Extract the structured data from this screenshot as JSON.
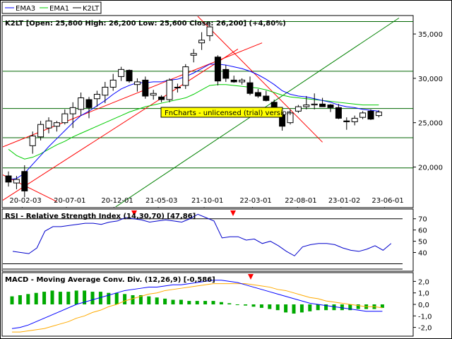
{
  "legend": {
    "ema3": "EMA3",
    "ema1": "EMA1",
    "k2lt": "K2LT"
  },
  "main_panel": {
    "header": "K2LT [Open: 25,800  High: 26,200  Low: 25,600  Close: 26,200] (+4,80%)",
    "watermark": "FnCharts - unlicensed (trial) version"
  },
  "rsi_panel": {
    "header": "RSI - Relative Strength Index (14,30,70) [47,86]"
  },
  "macd_panel": {
    "header": "MACD - Moving Average Conv. Div. (12,26,9) [-0,586]"
  },
  "colors": {
    "ema3": "#0000ff",
    "ema1": "#00cc00",
    "channel": "#ff0000",
    "trendline": "#008000",
    "hline": "#006600",
    "rsi": "#0000cc",
    "macd": "#0000ff",
    "macd_signal": "#ffaa00",
    "hist_pos": "#00aa00",
    "hist_neg": "#00aa00",
    "marker": "#ff0000",
    "watermark_bg": "#ffff00"
  },
  "chart_data": [
    {
      "type": "candlestick",
      "title": "K2LT",
      "x_labels": [
        "20-02-03",
        "20-07-01",
        "20-12-01",
        "21-05-03",
        "21-10-01",
        "22-03-01",
        "22-08-01",
        "23-01-02",
        "23-06-01"
      ],
      "ylim": [
        15500,
        37000
      ],
      "y_ticks": [
        20000,
        25000,
        30000,
        35000
      ],
      "y_tick_labels": [
        "20,000",
        "25,000",
        "30,000",
        "35,000"
      ],
      "candles": [
        {
          "o": 19000,
          "h": 19500,
          "l": 17800,
          "c": 18300
        },
        {
          "o": 18200,
          "h": 19000,
          "l": 17500,
          "c": 18600
        },
        {
          "o": 19500,
          "h": 20200,
          "l": 16600,
          "c": 17300
        },
        {
          "o": 22400,
          "h": 24000,
          "l": 21500,
          "c": 23500
        },
        {
          "o": 23400,
          "h": 25200,
          "l": 23000,
          "c": 24800
        },
        {
          "o": 24400,
          "h": 25600,
          "l": 23800,
          "c": 25200
        },
        {
          "o": 24600,
          "h": 25200,
          "l": 24000,
          "c": 25000
        },
        {
          "o": 25000,
          "h": 26500,
          "l": 24800,
          "c": 26000
        },
        {
          "o": 26000,
          "h": 27300,
          "l": 24400,
          "c": 26700
        },
        {
          "o": 26500,
          "h": 28400,
          "l": 25800,
          "c": 27800
        },
        {
          "o": 27600,
          "h": 27900,
          "l": 25500,
          "c": 26700
        },
        {
          "o": 27700,
          "h": 28600,
          "l": 26800,
          "c": 28200
        },
        {
          "o": 28100,
          "h": 29600,
          "l": 27200,
          "c": 29000
        },
        {
          "o": 29000,
          "h": 30500,
          "l": 28600,
          "c": 29800
        },
        {
          "o": 30200,
          "h": 31300,
          "l": 29700,
          "c": 31000
        },
        {
          "o": 30900,
          "h": 31000,
          "l": 29500,
          "c": 29700
        },
        {
          "o": 29300,
          "h": 30000,
          "l": 28500,
          "c": 29600
        },
        {
          "o": 29800,
          "h": 30200,
          "l": 27700,
          "c": 28000
        },
        {
          "o": 28100,
          "h": 28700,
          "l": 27600,
          "c": 28300
        },
        {
          "o": 27900,
          "h": 28100,
          "l": 27300,
          "c": 27600
        },
        {
          "o": 27600,
          "h": 30000,
          "l": 27300,
          "c": 29800
        },
        {
          "o": 29000,
          "h": 29400,
          "l": 28400,
          "c": 29000
        },
        {
          "o": 29200,
          "h": 31600,
          "l": 28800,
          "c": 31300
        },
        {
          "o": 32600,
          "h": 33300,
          "l": 31800,
          "c": 32800
        },
        {
          "o": 34000,
          "h": 35200,
          "l": 33200,
          "c": 34300
        },
        {
          "o": 34800,
          "h": 36200,
          "l": 34200,
          "c": 35800
        },
        {
          "o": 32400,
          "h": 32600,
          "l": 29200,
          "c": 29700
        },
        {
          "o": 31000,
          "h": 31500,
          "l": 29600,
          "c": 30000
        },
        {
          "o": 29800,
          "h": 30300,
          "l": 29500,
          "c": 29600
        },
        {
          "o": 29600,
          "h": 30000,
          "l": 29300,
          "c": 29800
        },
        {
          "o": 29500,
          "h": 30200,
          "l": 28100,
          "c": 28300
        },
        {
          "o": 28400,
          "h": 28800,
          "l": 27800,
          "c": 28000
        },
        {
          "o": 28000,
          "h": 28600,
          "l": 27400,
          "c": 27500
        },
        {
          "o": 27300,
          "h": 27600,
          "l": 26100,
          "c": 26400
        },
        {
          "o": 25900,
          "h": 26400,
          "l": 24100,
          "c": 24600
        },
        {
          "o": 25000,
          "h": 26500,
          "l": 24800,
          "c": 26100
        },
        {
          "o": 26300,
          "h": 27000,
          "l": 26100,
          "c": 26800
        },
        {
          "o": 26800,
          "h": 28000,
          "l": 26500,
          "c": 27000
        },
        {
          "o": 27000,
          "h": 28300,
          "l": 26500,
          "c": 27100
        },
        {
          "o": 27100,
          "h": 27800,
          "l": 26800,
          "c": 26800
        },
        {
          "o": 27000,
          "h": 27100,
          "l": 26200,
          "c": 26700
        },
        {
          "o": 26700,
          "h": 27100,
          "l": 25400,
          "c": 25500
        },
        {
          "o": 25200,
          "h": 25600,
          "l": 24200,
          "c": 25100
        },
        {
          "o": 25100,
          "h": 25800,
          "l": 24700,
          "c": 25500
        },
        {
          "o": 25600,
          "h": 26300,
          "l": 25400,
          "c": 26100
        },
        {
          "o": 26300,
          "h": 26500,
          "l": 25300,
          "c": 25400
        },
        {
          "o": 25800,
          "h": 26400,
          "l": 25600,
          "c": 26200
        }
      ],
      "ema3": [
        18600,
        18700,
        19300,
        20300,
        21300,
        22300,
        23200,
        24100,
        25000,
        25800,
        26300,
        26900,
        27500,
        28200,
        28800,
        29200,
        29500,
        29500,
        29600,
        29600,
        29800,
        29900,
        30200,
        30600,
        31100,
        31600,
        31600,
        31500,
        31300,
        31100,
        30800,
        30400,
        29900,
        29300,
        28600,
        28200,
        28000,
        27900,
        27700,
        27500,
        27300,
        27000,
        26800,
        26700,
        26500,
        26400,
        26300
      ],
      "ema1": [
        22000,
        21300,
        20900,
        21100,
        21500,
        22000,
        22500,
        22900,
        23400,
        23800,
        24200,
        24600,
        25000,
        25400,
        25800,
        26200,
        26500,
        26800,
        27000,
        27200,
        27400,
        27600,
        27800,
        28200,
        28700,
        29200,
        29300,
        29300,
        29200,
        29100,
        29000,
        28900,
        28700,
        28400,
        28100,
        27900,
        27800,
        27700,
        27600,
        27500,
        27400,
        27300,
        27200,
        27100,
        27000,
        27000,
        27000
      ],
      "series_names": [
        "EMA3",
        "EMA1",
        "K2LT"
      ],
      "horizontal_lines": [
        36400,
        30800,
        26600,
        23300,
        19900
      ],
      "trendlines": [
        {
          "name": "channel-lower",
          "color": "red",
          "from": {
            "i": -2,
            "v": 15500
          },
          "to": {
            "i": 28.5,
            "v": 33300
          }
        },
        {
          "name": "channel-upper",
          "color": "red",
          "from": {
            "i": -2,
            "v": 21800
          },
          "to": {
            "i": 31.5,
            "v": 34000
          }
        },
        {
          "name": "down-red-left",
          "color": "red",
          "from": {
            "i": -2,
            "v": 19700
          },
          "to": {
            "i": 6,
            "v": 16100
          }
        },
        {
          "name": "down-red-right",
          "color": "red",
          "from": {
            "i": 23.5,
            "v": 37000
          },
          "to": {
            "i": 39,
            "v": 22800
          }
        },
        {
          "name": "up-green",
          "color": "green",
          "from": {
            "i": 13.3,
            "v": 15500
          },
          "to": {
            "i": 48.5,
            "v": 36800
          }
        }
      ]
    },
    {
      "type": "line",
      "title": "RSI - Relative Strength Index (14,30,70) [47,86]",
      "ylim": [
        24,
        78
      ],
      "y_ticks": [
        40,
        50,
        60,
        70
      ],
      "y_tick_labels": [
        "40",
        "50",
        "60",
        "70"
      ],
      "levels": [
        30,
        70
      ],
      "values": [
        41,
        40,
        39,
        44,
        59,
        63,
        63,
        64,
        65,
        66,
        66,
        65,
        67,
        68,
        71,
        70,
        69,
        67,
        68,
        69,
        68,
        67,
        70,
        74,
        71,
        68,
        53,
        54,
        54,
        51,
        52,
        48,
        50,
        46,
        41,
        37,
        45,
        47,
        48,
        48,
        47,
        44,
        42,
        41,
        43,
        46,
        42,
        48
      ]
    },
    {
      "type": "line",
      "title": "MACD - Moving Average Conv. Div. (12,26,9) [-0,586]",
      "ylim": [
        -2.7,
        2.7
      ],
      "y_ticks": [
        -2.0,
        -1.0,
        0.0,
        1.0,
        2.0
      ],
      "y_tick_labels": [
        "-2,0",
        "-1,0",
        "0,0",
        "1,0",
        "2,0"
      ],
      "macd": [
        -2.1,
        -2.0,
        -1.8,
        -1.5,
        -1.2,
        -0.9,
        -0.6,
        -0.3,
        0.0,
        0.2,
        0.4,
        0.6,
        0.8,
        1.0,
        1.2,
        1.3,
        1.4,
        1.5,
        1.5,
        1.6,
        1.7,
        1.7,
        1.8,
        1.9,
        2.0,
        2.1,
        2.1,
        2.0,
        1.9,
        1.7,
        1.5,
        1.3,
        1.1,
        0.9,
        0.7,
        0.5,
        0.3,
        0.1,
        0.0,
        -0.1,
        -0.2,
        -0.3,
        -0.4,
        -0.5,
        -0.6,
        -0.6,
        -0.6
      ],
      "signal": [
        -2.4,
        -2.4,
        -2.3,
        -2.2,
        -2.1,
        -1.9,
        -1.7,
        -1.5,
        -1.2,
        -1.0,
        -0.7,
        -0.5,
        -0.2,
        0.0,
        0.3,
        0.5,
        0.7,
        0.9,
        1.0,
        1.2,
        1.3,
        1.4,
        1.5,
        1.6,
        1.7,
        1.8,
        1.8,
        1.8,
        1.8,
        1.8,
        1.7,
        1.6,
        1.5,
        1.3,
        1.2,
        1.0,
        0.8,
        0.6,
        0.5,
        0.3,
        0.2,
        0.1,
        0.0,
        -0.1,
        -0.2,
        -0.2,
        -0.3
      ],
      "histogram": [
        0.7,
        0.8,
        0.9,
        1.0,
        1.1,
        1.2,
        1.1,
        1.1,
        1.2,
        1.2,
        1.1,
        1.1,
        1.0,
        1.0,
        0.9,
        0.8,
        0.8,
        0.7,
        0.6,
        0.5,
        0.4,
        0.4,
        0.3,
        0.3,
        0.3,
        0.3,
        0.2,
        0.1,
        0.0,
        -0.1,
        -0.2,
        -0.3,
        -0.4,
        -0.5,
        -0.7,
        -0.8,
        -0.7,
        -0.6,
        -0.5,
        -0.5,
        -0.5,
        -0.5,
        -0.5,
        -0.4,
        -0.4,
        -0.4,
        -0.3
      ]
    }
  ]
}
